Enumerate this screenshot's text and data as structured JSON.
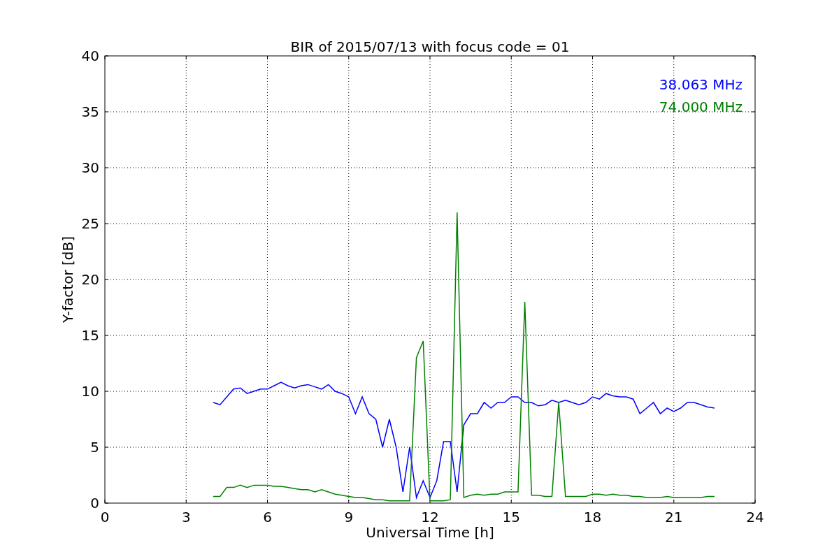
{
  "chart_data": {
    "type": "line",
    "title": "BIR of 2015/07/13 with focus code = 01",
    "xlabel": "Universal Time [h]",
    "ylabel": "Y-factor [dB]",
    "x": [
      4,
      4.25,
      4.5,
      4.75,
      5,
      5.25,
      5.5,
      5.75,
      6,
      6.25,
      6.5,
      6.75,
      7,
      7.25,
      7.5,
      7.75,
      8,
      8.25,
      8.5,
      8.75,
      9,
      9.25,
      9.5,
      9.75,
      10,
      10.25,
      10.5,
      10.75,
      11,
      11.25,
      11.5,
      11.75,
      12,
      12.25,
      12.5,
      12.75,
      13,
      13.25,
      13.5,
      13.75,
      14,
      14.25,
      14.5,
      14.75,
      15,
      15.25,
      15.5,
      15.75,
      16,
      16.25,
      16.5,
      16.75,
      17,
      17.25,
      17.5,
      17.75,
      18,
      18.25,
      18.5,
      18.75,
      19,
      19.25,
      19.5,
      19.75,
      20,
      20.25,
      20.5,
      20.75,
      21,
      21.25,
      21.5,
      21.75,
      22,
      22.25,
      22.5
    ],
    "series": [
      {
        "name": "38.063 MHz",
        "color": "#0000ff",
        "values": [
          9,
          8.8,
          9.5,
          10.2,
          10.3,
          9.8,
          10,
          10.2,
          10.2,
          10.5,
          10.8,
          10.5,
          10.3,
          10.5,
          10.6,
          10.4,
          10.2,
          10.6,
          10,
          9.8,
          9.5,
          8,
          9.5,
          8,
          7.5,
          5,
          7.5,
          5,
          1,
          5,
          0.5,
          2,
          0.5,
          2,
          5.5,
          5.5,
          1,
          7,
          8,
          8,
          9,
          8.5,
          9,
          9,
          9.5,
          9.5,
          9,
          9,
          8.7,
          8.8,
          9.2,
          9,
          9.2,
          9,
          8.8,
          9,
          9.5,
          9.3,
          9.8,
          9.6,
          9.5,
          9.5,
          9.3,
          8,
          8.5,
          9,
          8,
          8.5,
          8.2,
          8.5,
          9,
          9,
          8.8,
          8.6,
          8.5
        ]
      },
      {
        "name": "74.000 MHz",
        "color": "#008000",
        "values": [
          0.6,
          0.6,
          1.4,
          1.4,
          1.6,
          1.4,
          1.6,
          1.6,
          1.6,
          1.5,
          1.5,
          1.4,
          1.3,
          1.2,
          1.2,
          1,
          1.2,
          1,
          0.8,
          0.7,
          0.6,
          0.5,
          0.5,
          0.4,
          0.3,
          0.3,
          0.2,
          0.2,
          0.2,
          0.2,
          13,
          14.5,
          0.2,
          0.2,
          0.2,
          0.3,
          26,
          0.5,
          0.7,
          0.8,
          0.7,
          0.8,
          0.8,
          1,
          1,
          1,
          18,
          0.7,
          0.7,
          0.6,
          0.6,
          9,
          0.6,
          0.6,
          0.6,
          0.6,
          0.8,
          0.8,
          0.7,
          0.8,
          0.7,
          0.7,
          0.6,
          0.6,
          0.5,
          0.5,
          0.5,
          0.6,
          0.5,
          0.5,
          0.5,
          0.5,
          0.5,
          0.6,
          0.6
        ]
      }
    ],
    "grid": true,
    "xlim": [
      0,
      24
    ],
    "ylim": [
      0,
      40
    ],
    "xticks": [
      0,
      3,
      6,
      9,
      12,
      15,
      18,
      21,
      24
    ],
    "yticks": [
      0,
      5,
      10,
      15,
      20,
      25,
      30,
      35,
      40
    ]
  }
}
